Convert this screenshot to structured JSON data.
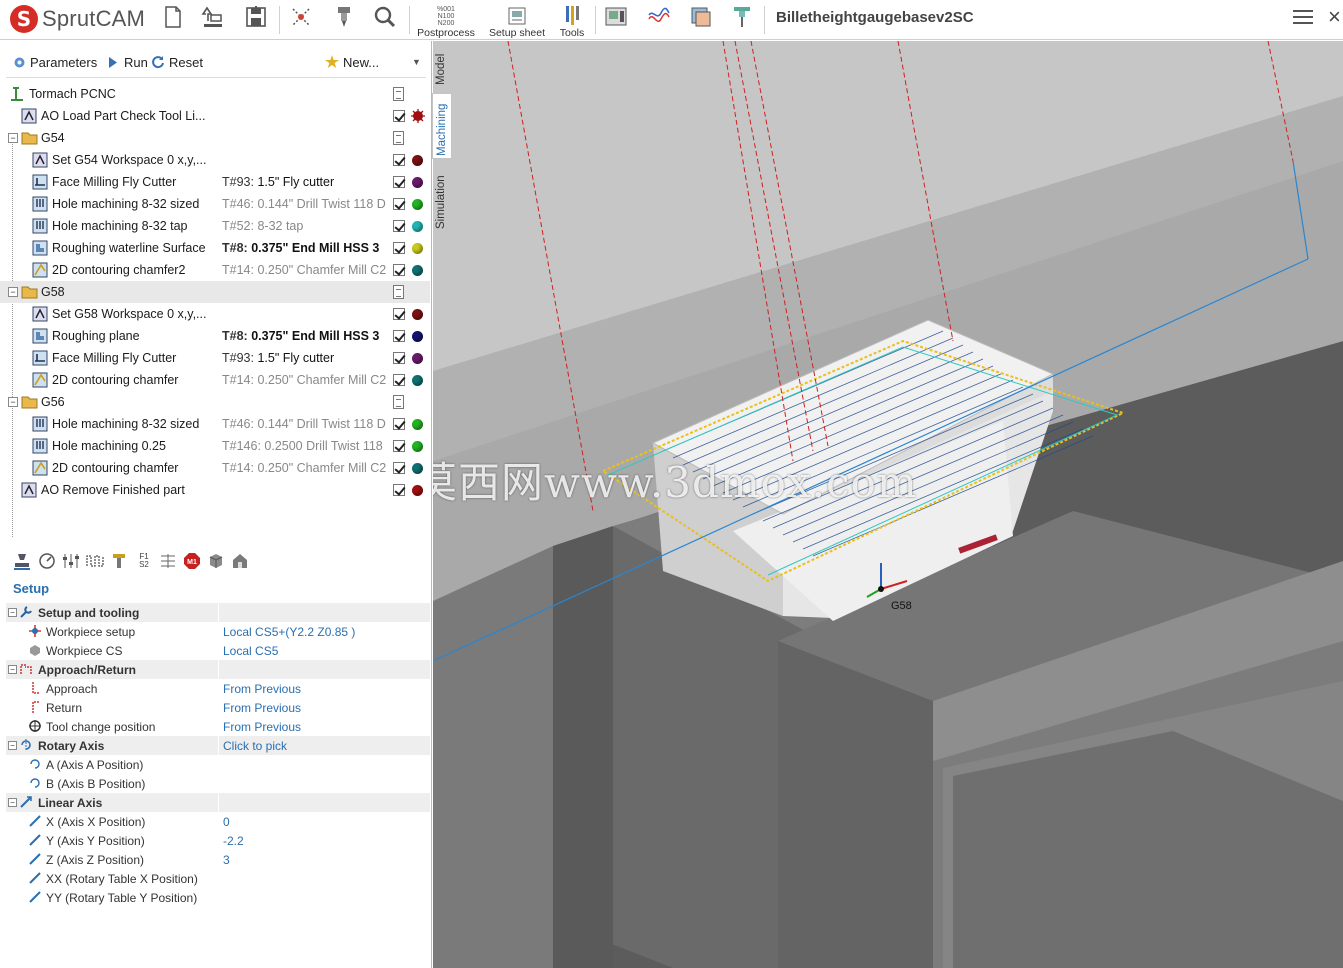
{
  "app": {
    "brand": "SprutCAM",
    "document_title": "Billetheightgaugebasev2SC"
  },
  "toolbar": {
    "postprocess_label": "Postprocess",
    "postprocess_glyph": [
      "%001",
      "N100",
      "N200"
    ],
    "setup_sheet_label": "Setup sheet",
    "tools_label": "Tools",
    "close_glyph": "×"
  },
  "op_toolbar": {
    "parameters": "Parameters",
    "run": "Run",
    "reset": "Reset",
    "new": "New..."
  },
  "tree": {
    "machine": "Tormach PCNC",
    "load_op": "AO Load Part Check Tool Li...",
    "groups": [
      {
        "name": "G54",
        "ops": [
          {
            "name": "Set G54 Workspace 0 x,y,...",
            "tool_no": "",
            "tool": "",
            "color": "#7a1212"
          },
          {
            "name": "Face Milling Fly Cutter",
            "tool_no": "T#93:",
            "tool": "1.5\" Fly cutter",
            "color": "#6a1a6a"
          },
          {
            "name": "Hole machining 8-32 sized",
            "tool_no": "T#46:",
            "tool": "0.144\" Drill Twist 118 D",
            "color": "#22b322"
          },
          {
            "name": "Hole machining 8-32 tap",
            "tool_no": "T#52:",
            "tool": "8-32 tap",
            "color": "#22b5b5"
          },
          {
            "name": "Roughing waterline Surface",
            "tool_no": "T#8:",
            "tool": "0.375\" End Mill HSS 3",
            "color": "#c9c91e"
          },
          {
            "name": "2D contouring chamfer2",
            "tool_no": "T#14:",
            "tool": "0.250\" Chamfer Mill C2",
            "color": "#117070"
          }
        ]
      },
      {
        "name": "G58",
        "ops": [
          {
            "name": "Set G58 Workspace 0 x,y,...",
            "tool_no": "",
            "tool": "",
            "color": "#7a1212"
          },
          {
            "name": "Roughing plane",
            "tool_no": "T#8:",
            "tool": "0.375\" End Mill HSS 3",
            "color": "#14146e"
          },
          {
            "name": "Face Milling Fly Cutter",
            "tool_no": "T#93:",
            "tool": "1.5\" Fly cutter",
            "color": "#6a1a6a"
          },
          {
            "name": "2D contouring chamfer",
            "tool_no": "T#14:",
            "tool": "0.250\" Chamfer Mill C2",
            "color": "#117070"
          }
        ]
      },
      {
        "name": "G56",
        "ops": [
          {
            "name": "Hole machining 8-32 sized",
            "tool_no": "T#46:",
            "tool": "0.144\" Drill Twist 118 D",
            "color": "#22b322"
          },
          {
            "name": "Hole machining 0.25",
            "tool_no": "T#146:",
            "tool": "0.2500 Drill Twist 118",
            "color": "#22b322"
          },
          {
            "name": "2D contouring chamfer",
            "tool_no": "T#14:",
            "tool": "0.250\" Chamfer Mill C2",
            "color": "#117070"
          }
        ]
      }
    ],
    "remove_op": "AO Remove Finished part"
  },
  "props_toolbar": {
    "f1s2_top": "F1",
    "f1s2_bottom": "S2",
    "m1": "M1"
  },
  "props": {
    "tab": "Setup",
    "setup_tooling": {
      "label": "Setup and tooling",
      "workpiece_setup": {
        "label": "Workpiece setup",
        "value": "Local CS5+(Y2.2 Z0.85 )"
      },
      "workpiece_cs": {
        "label": "Workpiece CS",
        "value": "Local CS5"
      }
    },
    "approach_return": {
      "label": "Approach/Return",
      "approach": {
        "label": "Approach",
        "value": "From Previous"
      },
      "return": {
        "label": "Return",
        "value": "From Previous"
      },
      "tool_change": {
        "label": "Tool change position",
        "value": "From Previous"
      }
    },
    "rotary": {
      "label": "Rotary Axis",
      "value": "Click to pick",
      "a": {
        "label": "A (Axis A Position)"
      },
      "b": {
        "label": "B (Axis B Position)"
      }
    },
    "linear": {
      "label": "Linear Axis",
      "x": {
        "label": "X (Axis X Position)",
        "value": "0"
      },
      "y": {
        "label": "Y (Axis Y Position)",
        "value": "-2.2"
      },
      "z": {
        "label": "Z (Axis Z Position)",
        "value": "3"
      },
      "xx": {
        "label": "XX (Rotary Table X Position)"
      },
      "yy": {
        "label": "YY (Rotary Table Y Position)"
      }
    }
  },
  "side_tabs": {
    "model": "Model",
    "machining": "Machining",
    "simulation": "Simulation"
  },
  "viewport": {
    "cs_label": "G58",
    "watermark": "莫西网www.3dmox.com"
  },
  "colors": {
    "accent": "#2a6fb0",
    "brand_red": "#d62c26"
  }
}
